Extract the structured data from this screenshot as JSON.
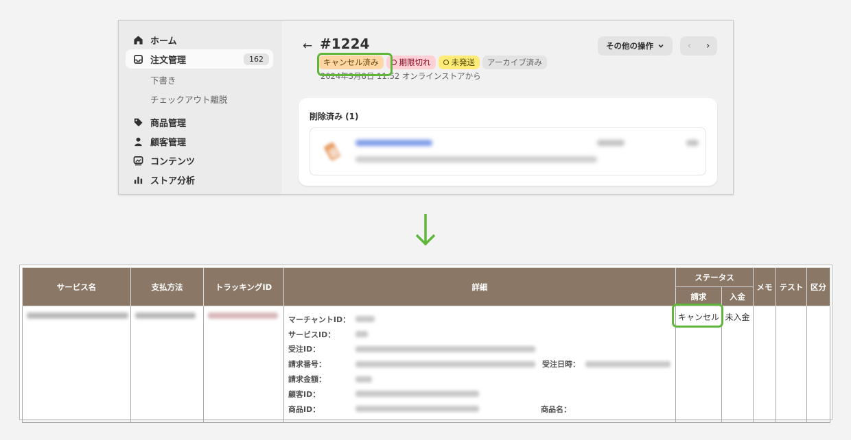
{
  "sidebar": {
    "items": [
      {
        "label": "ホーム",
        "icon": "home-icon"
      },
      {
        "label": "注文管理",
        "icon": "inbox-icon",
        "count": "162",
        "active": true
      },
      {
        "label": "商品管理",
        "icon": "tag-icon"
      },
      {
        "label": "顧客管理",
        "icon": "person-icon"
      },
      {
        "label": "コンテンツ",
        "icon": "image-icon"
      },
      {
        "label": "ストア分析",
        "icon": "bar-chart-icon"
      }
    ],
    "sub_items": [
      "下書き",
      "チェックアウト離脱"
    ]
  },
  "order": {
    "back": "←",
    "title": "#1224",
    "badges": {
      "cancel": "キャンセル済み",
      "expired": "期限切れ",
      "unshipped": "未発送",
      "archived": "アーカイブ済み"
    },
    "meta": "2024年3月8日 11:52 オンラインストアから",
    "other_actions": "その他の操作",
    "pager_prev": "‹",
    "pager_next": "›",
    "card_title": "削除済み (1)"
  },
  "colors": {
    "highlight": "#5fb63a",
    "table_header": "#8a7766",
    "cancel_badge": "#ffd6a4",
    "expired_badge": "#fed1d7",
    "unshipped_badge": "#ffeb78"
  },
  "table": {
    "headers": {
      "service": "サービス名",
      "payment": "支払方法",
      "tracking": "トラッキングID",
      "detail": "詳細",
      "status": "ステータス",
      "billing": "請求",
      "deposit": "入金",
      "memo": "メモ",
      "test": "テスト",
      "category": "区分"
    },
    "detail_labels": {
      "merchant_id": "マーチャントID：",
      "service_id": "サービスID：",
      "order_id": "受注ID：",
      "invoice_no": "請求番号：",
      "order_datetime": "受注日時：",
      "amount": "請求金額：",
      "customer_id": "顧客ID：",
      "product_id": "商品ID：",
      "product_name": "商品名："
    },
    "row": {
      "billing_status": "キャンセル",
      "deposit_status": "未入金"
    }
  }
}
